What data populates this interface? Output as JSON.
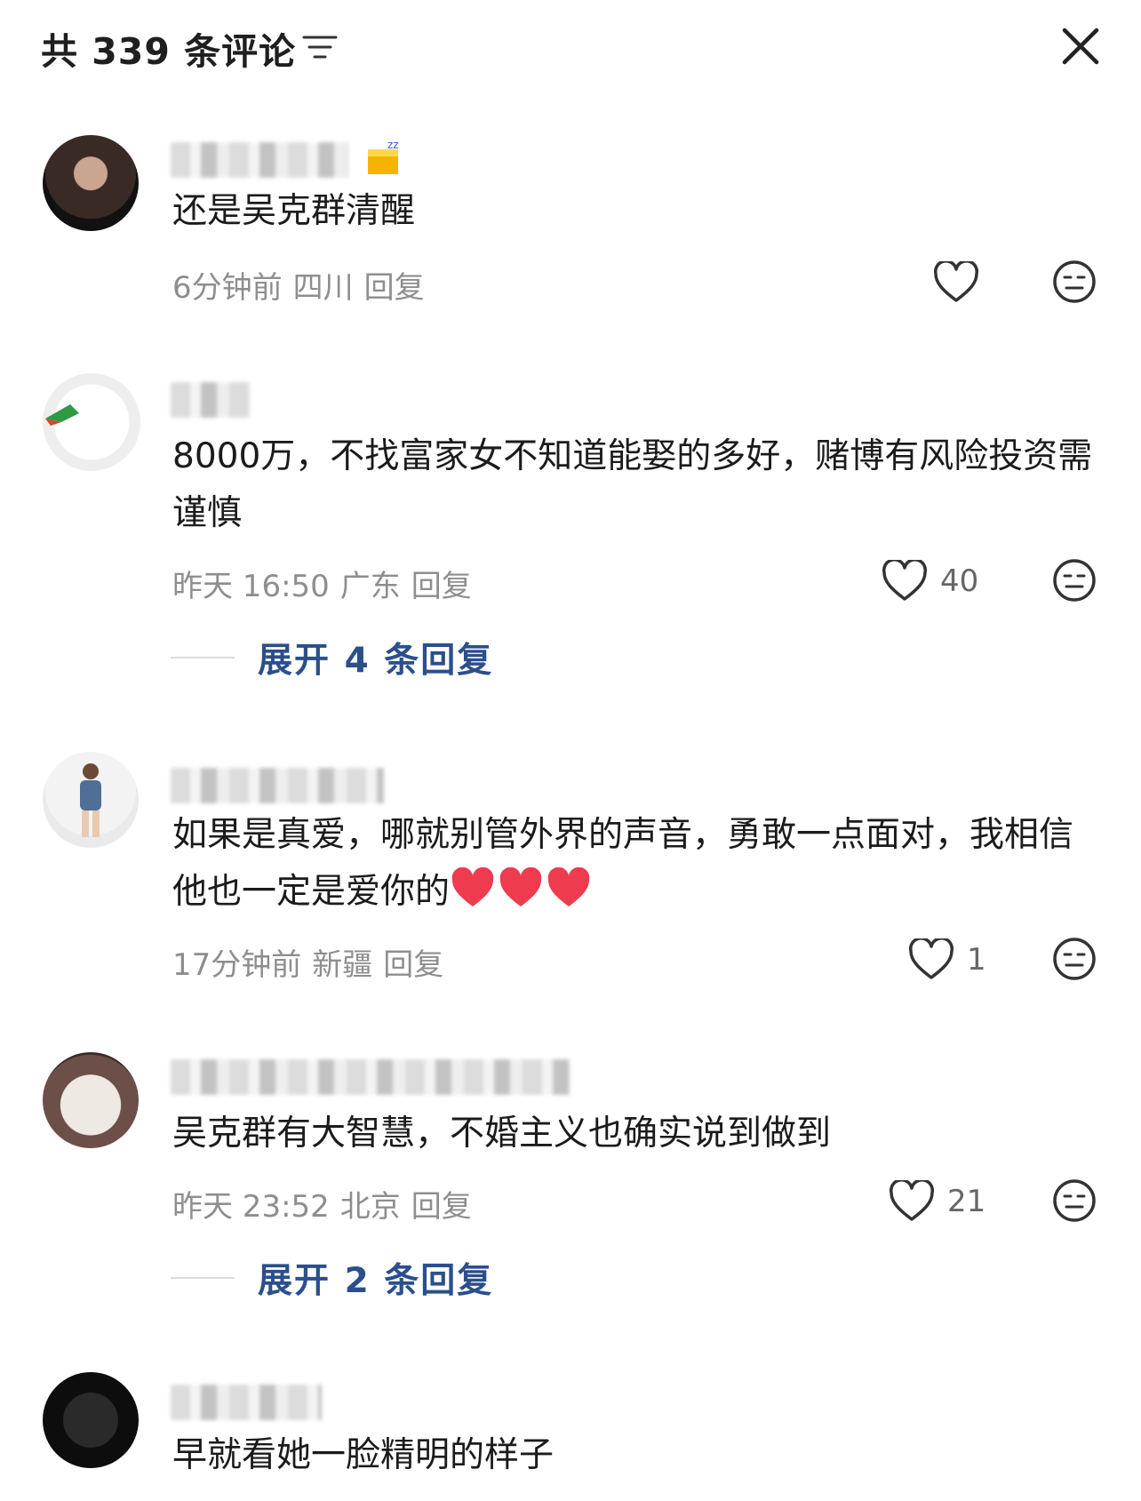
{
  "header": {
    "title": "共 339 条评论"
  },
  "comments": [
    {
      "text": "还是吴克群清醒",
      "time": "6分钟前",
      "location": "四川",
      "reply": "回复",
      "likes": ""
    },
    {
      "text": "8000万，不找富家女不知道能娶的多好，赌博有风险投资需谨慎",
      "time": "昨天 16:50",
      "location": "广东",
      "reply": "回复",
      "likes": "40",
      "expand": "展开 4 条回复"
    },
    {
      "text": "如果是真爱，哪就别管外界的声音，勇敢一点面对，我相信他也一定是爱你的",
      "time": "17分钟前",
      "location": "新疆",
      "reply": "回复",
      "likes": "1"
    },
    {
      "text": "吴克群有大智慧，不婚主义也确实说到做到",
      "time": "昨天 23:52",
      "location": "北京",
      "reply": "回复",
      "likes": "21",
      "expand": "展开 2 条回复"
    },
    {
      "text": "早就看她一脸精明的样子"
    }
  ],
  "icons": {
    "sort": "sort-lines-icon",
    "close": "close-icon",
    "like": "heart-outline-icon",
    "dislike": "neutral-face-icon",
    "emoji": "red-heart-emoji"
  },
  "colors": {
    "expand_link": "#2b4f8c",
    "meta": "#8e8e8e",
    "heart_emoji": "#ee3b4f"
  }
}
